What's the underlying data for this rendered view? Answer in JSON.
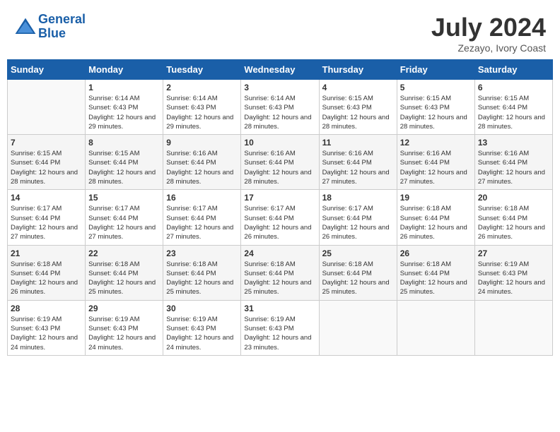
{
  "header": {
    "logo_line1": "General",
    "logo_line2": "Blue",
    "month": "July 2024",
    "location": "Zezayo, Ivory Coast"
  },
  "weekdays": [
    "Sunday",
    "Monday",
    "Tuesday",
    "Wednesday",
    "Thursday",
    "Friday",
    "Saturday"
  ],
  "weeks": [
    [
      {
        "day": "",
        "empty": true
      },
      {
        "day": "1",
        "sunrise": "6:14 AM",
        "sunset": "6:43 PM",
        "daylight": "12 hours and 29 minutes."
      },
      {
        "day": "2",
        "sunrise": "6:14 AM",
        "sunset": "6:43 PM",
        "daylight": "12 hours and 29 minutes."
      },
      {
        "day": "3",
        "sunrise": "6:14 AM",
        "sunset": "6:43 PM",
        "daylight": "12 hours and 28 minutes."
      },
      {
        "day": "4",
        "sunrise": "6:15 AM",
        "sunset": "6:43 PM",
        "daylight": "12 hours and 28 minutes."
      },
      {
        "day": "5",
        "sunrise": "6:15 AM",
        "sunset": "6:43 PM",
        "daylight": "12 hours and 28 minutes."
      },
      {
        "day": "6",
        "sunrise": "6:15 AM",
        "sunset": "6:44 PM",
        "daylight": "12 hours and 28 minutes."
      }
    ],
    [
      {
        "day": "7",
        "sunrise": "6:15 AM",
        "sunset": "6:44 PM",
        "daylight": "12 hours and 28 minutes."
      },
      {
        "day": "8",
        "sunrise": "6:15 AM",
        "sunset": "6:44 PM",
        "daylight": "12 hours and 28 minutes."
      },
      {
        "day": "9",
        "sunrise": "6:16 AM",
        "sunset": "6:44 PM",
        "daylight": "12 hours and 28 minutes."
      },
      {
        "day": "10",
        "sunrise": "6:16 AM",
        "sunset": "6:44 PM",
        "daylight": "12 hours and 28 minutes."
      },
      {
        "day": "11",
        "sunrise": "6:16 AM",
        "sunset": "6:44 PM",
        "daylight": "12 hours and 27 minutes."
      },
      {
        "day": "12",
        "sunrise": "6:16 AM",
        "sunset": "6:44 PM",
        "daylight": "12 hours and 27 minutes."
      },
      {
        "day": "13",
        "sunrise": "6:16 AM",
        "sunset": "6:44 PM",
        "daylight": "12 hours and 27 minutes."
      }
    ],
    [
      {
        "day": "14",
        "sunrise": "6:17 AM",
        "sunset": "6:44 PM",
        "daylight": "12 hours and 27 minutes."
      },
      {
        "day": "15",
        "sunrise": "6:17 AM",
        "sunset": "6:44 PM",
        "daylight": "12 hours and 27 minutes."
      },
      {
        "day": "16",
        "sunrise": "6:17 AM",
        "sunset": "6:44 PM",
        "daylight": "12 hours and 27 minutes."
      },
      {
        "day": "17",
        "sunrise": "6:17 AM",
        "sunset": "6:44 PM",
        "daylight": "12 hours and 26 minutes."
      },
      {
        "day": "18",
        "sunrise": "6:17 AM",
        "sunset": "6:44 PM",
        "daylight": "12 hours and 26 minutes."
      },
      {
        "day": "19",
        "sunrise": "6:18 AM",
        "sunset": "6:44 PM",
        "daylight": "12 hours and 26 minutes."
      },
      {
        "day": "20",
        "sunrise": "6:18 AM",
        "sunset": "6:44 PM",
        "daylight": "12 hours and 26 minutes."
      }
    ],
    [
      {
        "day": "21",
        "sunrise": "6:18 AM",
        "sunset": "6:44 PM",
        "daylight": "12 hours and 26 minutes."
      },
      {
        "day": "22",
        "sunrise": "6:18 AM",
        "sunset": "6:44 PM",
        "daylight": "12 hours and 25 minutes."
      },
      {
        "day": "23",
        "sunrise": "6:18 AM",
        "sunset": "6:44 PM",
        "daylight": "12 hours and 25 minutes."
      },
      {
        "day": "24",
        "sunrise": "6:18 AM",
        "sunset": "6:44 PM",
        "daylight": "12 hours and 25 minutes."
      },
      {
        "day": "25",
        "sunrise": "6:18 AM",
        "sunset": "6:44 PM",
        "daylight": "12 hours and 25 minutes."
      },
      {
        "day": "26",
        "sunrise": "6:18 AM",
        "sunset": "6:44 PM",
        "daylight": "12 hours and 25 minutes."
      },
      {
        "day": "27",
        "sunrise": "6:19 AM",
        "sunset": "6:43 PM",
        "daylight": "12 hours and 24 minutes."
      }
    ],
    [
      {
        "day": "28",
        "sunrise": "6:19 AM",
        "sunset": "6:43 PM",
        "daylight": "12 hours and 24 minutes."
      },
      {
        "day": "29",
        "sunrise": "6:19 AM",
        "sunset": "6:43 PM",
        "daylight": "12 hours and 24 minutes."
      },
      {
        "day": "30",
        "sunrise": "6:19 AM",
        "sunset": "6:43 PM",
        "daylight": "12 hours and 24 minutes."
      },
      {
        "day": "31",
        "sunrise": "6:19 AM",
        "sunset": "6:43 PM",
        "daylight": "12 hours and 23 minutes."
      },
      {
        "day": "",
        "empty": true
      },
      {
        "day": "",
        "empty": true
      },
      {
        "day": "",
        "empty": true
      }
    ]
  ]
}
